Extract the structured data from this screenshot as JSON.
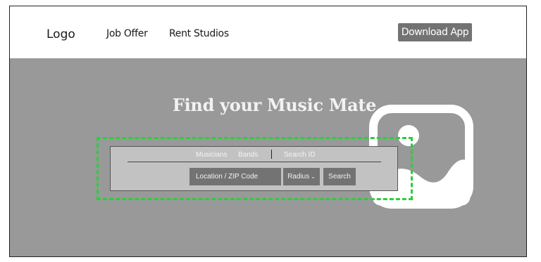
{
  "navbar": {
    "logo": "Logo",
    "links": [
      "Job Offer",
      "Rent Studios"
    ],
    "download_label": "Download App"
  },
  "hero": {
    "title": "Find your Music Mate",
    "image_icon": "image-placeholder-icon"
  },
  "search": {
    "tabs": [
      "Musicians",
      "Bands",
      "Search ID"
    ],
    "location_placeholder": "Location / ZIP Code",
    "radius_label": "Radius",
    "radius_icon": "chevron-down-icon",
    "search_label": "Search"
  },
  "colors": {
    "hero_background": "#999999",
    "panel_background": "#c2c2c2",
    "control_background": "#737373",
    "highlight": "#2ecc40"
  }
}
